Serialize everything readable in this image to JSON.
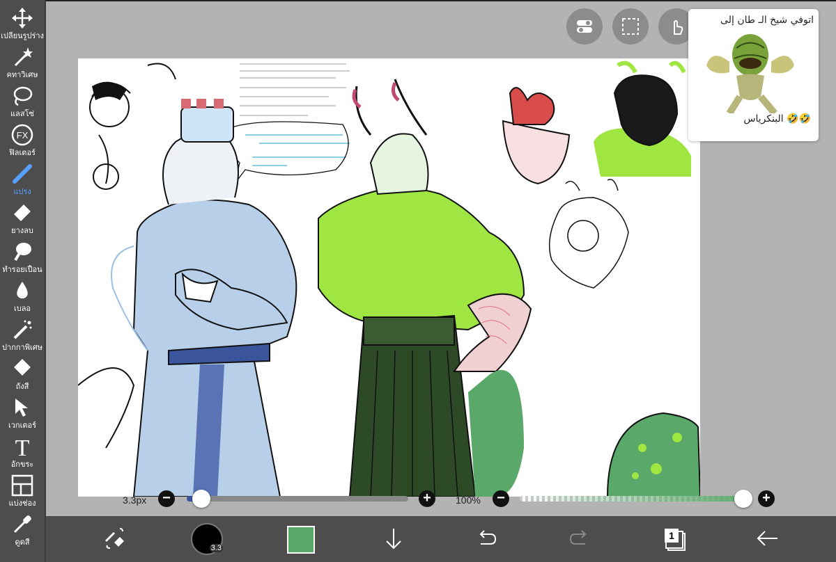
{
  "tools": [
    {
      "name": "transform",
      "label": "เปลี่ยนรูปร่าง",
      "icon": "move-arrows-icon"
    },
    {
      "name": "magic-wand",
      "label": "คทาวิเศษ",
      "icon": "magic-wand-icon"
    },
    {
      "name": "lasso",
      "label": "แลสโซ่",
      "icon": "lasso-icon"
    },
    {
      "name": "filter",
      "label": "ฟิลเตอร์",
      "icon": "fx-icon"
    },
    {
      "name": "brush",
      "label": "แปรง",
      "icon": "brush-icon",
      "active": true
    },
    {
      "name": "eraser",
      "label": "ยางลบ",
      "icon": "eraser-icon"
    },
    {
      "name": "smudge",
      "label": "ทำรอยเปื้อน",
      "icon": "smudge-icon"
    },
    {
      "name": "blur",
      "label": "เบลอ",
      "icon": "blur-drop-icon"
    },
    {
      "name": "special-pen",
      "label": "ปากกาพิเศษ",
      "icon": "special-pen-icon"
    },
    {
      "name": "fill",
      "label": "ถังสี",
      "icon": "bucket-icon"
    },
    {
      "name": "vector",
      "label": "เวกเตอร์",
      "icon": "cursor-arrow-icon"
    },
    {
      "name": "text",
      "label": "อักขระ",
      "icon": "text-t-icon"
    },
    {
      "name": "frame",
      "label": "แบ่งช่อง",
      "icon": "frame-divider-icon"
    },
    {
      "name": "eyedropper",
      "label": "ดูดสี",
      "icon": "eyedropper-icon"
    }
  ],
  "sticker": {
    "caption_top": "اتوفي شيخ الـ طان إلى",
    "caption_bottom": "البنكرياس 🤣🤣"
  },
  "brush_size": {
    "value_label": "3.3px",
    "fraction": 0.06
  },
  "opacity": {
    "value_label": "100%",
    "fraction": 1.0
  },
  "bottom_bar": {
    "brush_size_badge": "3.3",
    "current_color": "#5aa86a",
    "layer_count": "1"
  },
  "colors": {
    "toolbar_bg": "#4d4d4d",
    "accent": "#5aa0ff",
    "workspace_bg": "#b3b3b3"
  }
}
